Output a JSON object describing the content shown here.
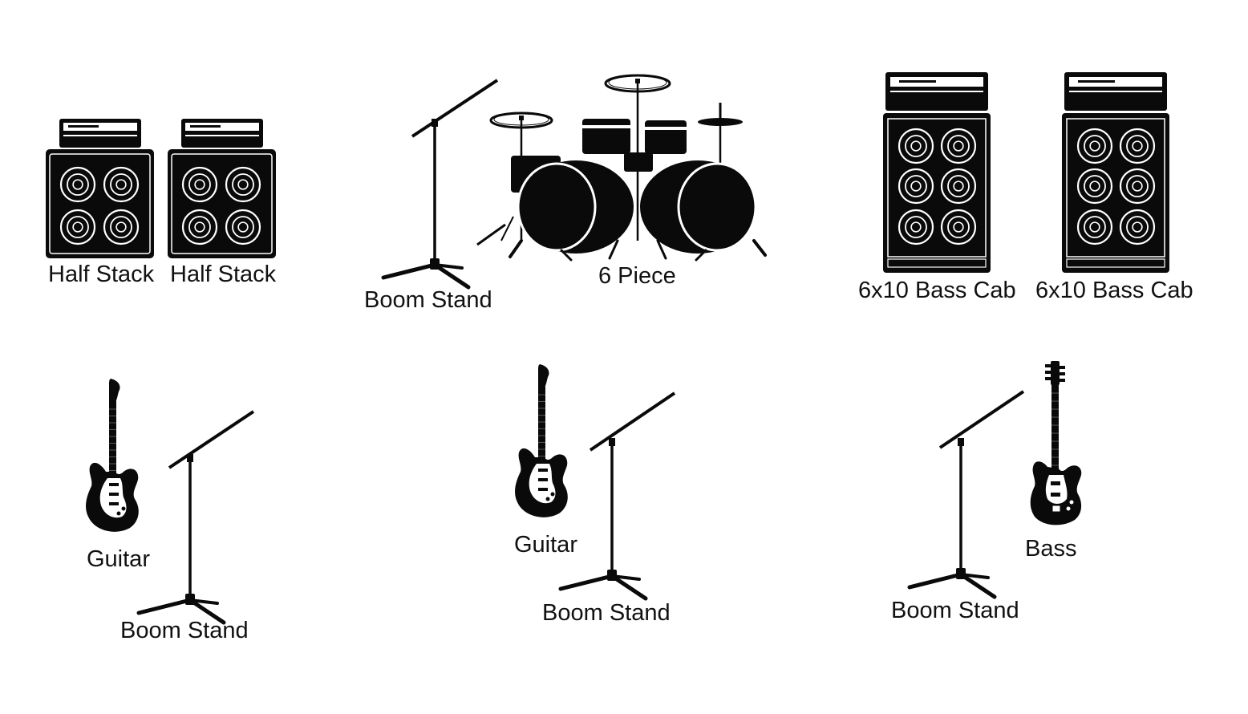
{
  "stage_plot": {
    "colors": {
      "ink": "#0a0a0a",
      "background": "#ffffff",
      "highlight": "#ffffff",
      "guitar_guard": "#ffffff"
    },
    "icons": [
      "half-stack-icon",
      "half-stack-icon",
      "boom-stand-icon",
      "drum-kit-icon",
      "bass-cab-icon",
      "bass-cab-icon",
      "guitar-icon",
      "boom-stand-icon",
      "guitar-icon",
      "boom-stand-icon",
      "bass-guitar-icon",
      "boom-stand-icon"
    ],
    "labels": {
      "half_stack_1": "Half Stack",
      "half_stack_2": "Half Stack",
      "boom_stand_top": "Boom Stand",
      "drums": "6 Piece",
      "bass_cab_1": "6x10 Bass Cab",
      "bass_cab_2": "6x10 Bass Cab",
      "guitar_1": "Guitar",
      "boom_stand_1": "Boom Stand",
      "guitar_2": "Guitar",
      "boom_stand_2": "Boom Stand",
      "bass": "Bass",
      "boom_stand_3": "Boom Stand"
    }
  }
}
